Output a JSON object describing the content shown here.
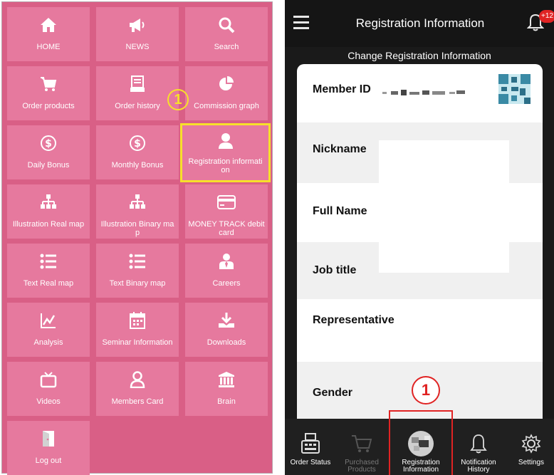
{
  "left_menu": {
    "tiles": [
      {
        "label": "HOME",
        "icon": "home-icon"
      },
      {
        "label": "NEWS",
        "icon": "megaphone-icon"
      },
      {
        "label": "Search",
        "icon": "search-icon"
      },
      {
        "label": "Order products",
        "icon": "cart-icon"
      },
      {
        "label": "Order history",
        "icon": "receipt-icon"
      },
      {
        "label": "Commission graph",
        "icon": "pie-chart-icon"
      },
      {
        "label": "Daily Bonus",
        "icon": "dollar-coin-icon"
      },
      {
        "label": "Monthly Bonus",
        "icon": "dollar-coin-icon"
      },
      {
        "label": "Registration informati on",
        "icon": "user-icon"
      },
      {
        "label": "Illustration Real map",
        "icon": "org-chart-icon"
      },
      {
        "label": "Illustration Binary ma p",
        "icon": "org-chart-icon"
      },
      {
        "label": "MONEY TRACK debit card",
        "icon": "credit-card-icon"
      },
      {
        "label": "Text Real map",
        "icon": "list-icon"
      },
      {
        "label": "Text Binary map",
        "icon": "list-icon"
      },
      {
        "label": "Careers",
        "icon": "businessman-icon"
      },
      {
        "label": "Analysis",
        "icon": "line-chart-icon"
      },
      {
        "label": "Seminar Information",
        "icon": "calendar-icon"
      },
      {
        "label": "Downloads",
        "icon": "download-icon"
      },
      {
        "label": "Videos",
        "icon": "tv-icon"
      },
      {
        "label": "Members Card",
        "icon": "member-icon"
      },
      {
        "label": "Brain",
        "icon": "bank-icon"
      },
      {
        "label": "Log out",
        "icon": "logout-icon"
      }
    ],
    "callout": "1"
  },
  "phone": {
    "header_title": "Registration Information",
    "bell_badge": "+12",
    "page_title": "Change Registration Information",
    "fields": [
      {
        "label": "Member ID"
      },
      {
        "label": "Nickname"
      },
      {
        "label": "Full Name"
      },
      {
        "label": "Job title"
      },
      {
        "label": "Representative"
      },
      {
        "label": "Gender"
      }
    ],
    "callout": "1",
    "bottom_nav": [
      {
        "label": "Order Status",
        "icon": "cash-register-icon"
      },
      {
        "label": "Purchased Products",
        "icon": "cart-icon"
      },
      {
        "label": "Registration Information",
        "icon": "avatar-icon"
      },
      {
        "label": "Notification History",
        "icon": "bell-icon"
      },
      {
        "label": "Settings",
        "icon": "gear-icon"
      }
    ]
  },
  "colors": {
    "tile": "#e6799e",
    "panel": "#d95f86",
    "highlight": "#f7e02a",
    "alert": "#e02323",
    "dark": "#1a1a1a"
  }
}
